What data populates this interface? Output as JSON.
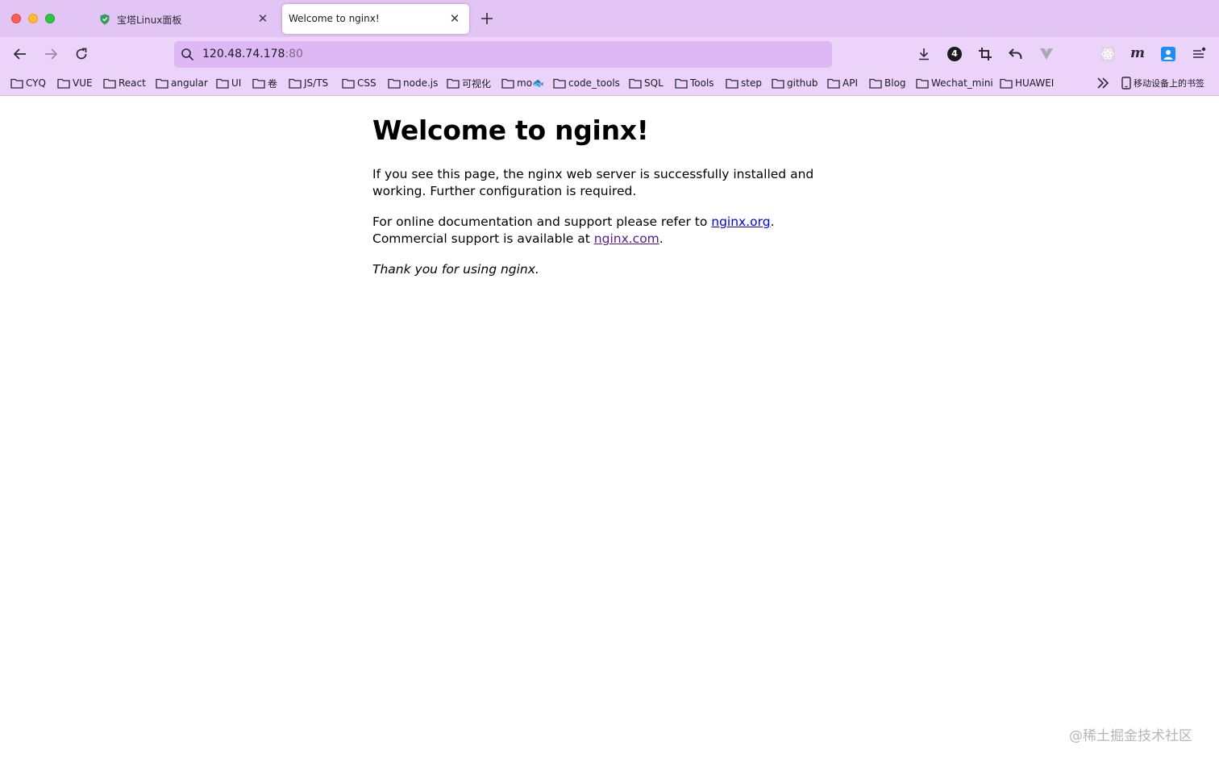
{
  "tabs": [
    {
      "title": "宝塔Linux面板",
      "active": false,
      "favicon": "shield-icon"
    },
    {
      "title": "Welcome to nginx!",
      "active": true
    }
  ],
  "navbar": {
    "url_host": "120.48.74.178",
    "url_port": ":80",
    "badge_count": "4"
  },
  "bookmarks": [
    "CYQ",
    "VUE",
    "React",
    "angular",
    "UI",
    "卷",
    "JS/TS",
    "CSS",
    "node.js",
    "可视化",
    "mo🐟",
    "code_tools",
    "SQL",
    "Tools",
    "step",
    "github",
    "API",
    "Blog",
    "Wechat_mini",
    "HUAWEI"
  ],
  "mobile_bookmarks": "移动设备上的书签",
  "page": {
    "heading": "Welcome to nginx!",
    "para1": "If you see this page, the nginx web server is successfully installed and working. Further configuration is required.",
    "para2_prefix": "For online documentation and support please refer to ",
    "link_org": "nginx.org",
    "para2_mid": ".",
    "para2_line2": "Commercial support is available at ",
    "link_com": "nginx.com",
    "para2_end": ".",
    "thanks": "Thank you for using nginx."
  },
  "watermark": "@稀土掘金技术社区",
  "colors": {
    "tabbar_bg": "#e2c5f4",
    "toolbar_bg": "#ebd3fa",
    "urlbar_bg": "#deb8f4",
    "link": "#0000ee",
    "visited_link": "#551a8b"
  }
}
